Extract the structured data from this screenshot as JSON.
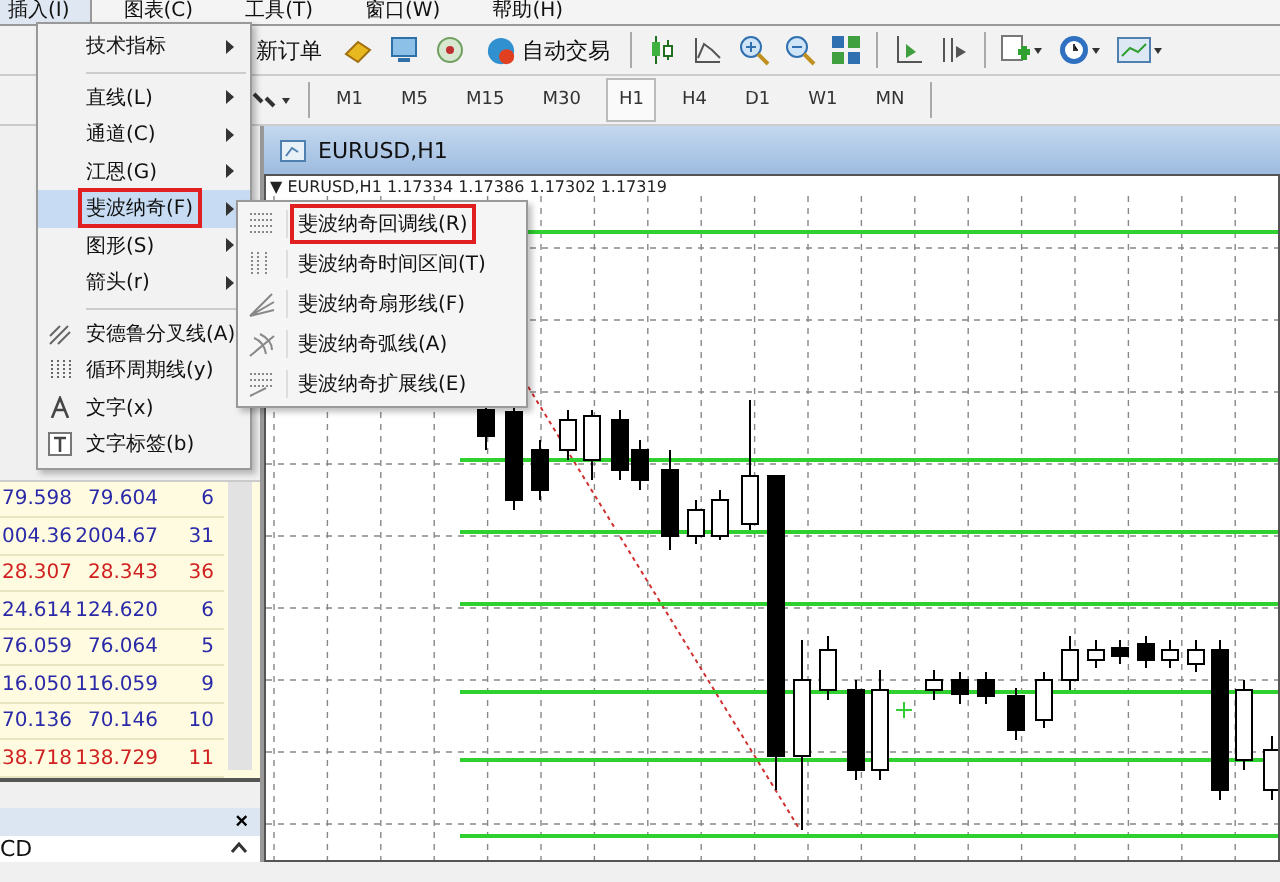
{
  "menu_bar": [
    {
      "label": "插入(I)",
      "selected": true
    },
    {
      "label": "图表(C)",
      "selected": false
    },
    {
      "label": "工具(T)",
      "selected": false
    },
    {
      "label": "窗口(W)",
      "selected": false
    },
    {
      "label": "帮助(H)",
      "selected": false
    }
  ],
  "toolbar": {
    "new_order": "新订单",
    "auto_trading": "自动交易"
  },
  "timeframes": [
    {
      "label": "M1",
      "selected": false
    },
    {
      "label": "M5",
      "selected": false
    },
    {
      "label": "M15",
      "selected": false
    },
    {
      "label": "M30",
      "selected": false
    },
    {
      "label": "H1",
      "selected": true
    },
    {
      "label": "H4",
      "selected": false
    },
    {
      "label": "D1",
      "selected": false
    },
    {
      "label": "W1",
      "selected": false
    },
    {
      "label": "MN",
      "selected": false
    }
  ],
  "insert_menu": {
    "groups": [
      [
        {
          "label": "技术指标",
          "submenu": true,
          "selected": false
        }
      ],
      [
        {
          "label": "直线(L)",
          "submenu": true,
          "selected": false
        },
        {
          "label": "通道(C)",
          "submenu": true,
          "selected": false
        },
        {
          "label": "江恩(G)",
          "submenu": true,
          "selected": false
        },
        {
          "label": "斐波纳奇(F)",
          "submenu": true,
          "selected": true
        },
        {
          "label": "图形(S)",
          "submenu": true,
          "selected": false
        },
        {
          "label": "箭头(r)",
          "submenu": true,
          "selected": false
        }
      ],
      [
        {
          "label": "安德鲁分叉线(A)",
          "submenu": false,
          "selected": false
        },
        {
          "label": "循环周期线(y)",
          "submenu": false,
          "selected": false
        },
        {
          "label": "文字(x)",
          "submenu": false,
          "selected": false
        },
        {
          "label": "文字标签(b)",
          "submenu": false,
          "selected": false
        }
      ]
    ]
  },
  "fibonacci_submenu": [
    {
      "label": "斐波纳奇回调线(R)",
      "selected": true
    },
    {
      "label": "斐波纳奇时间区间(T)",
      "selected": false
    },
    {
      "label": "斐波纳奇扇形线(F)",
      "selected": false
    },
    {
      "label": "斐波纳奇弧线(A)",
      "selected": false
    },
    {
      "label": "斐波纳奇扩展线(E)",
      "selected": false
    }
  ],
  "market_watch": {
    "rows": [
      {
        "bid": "79.598",
        "ask": "79.604",
        "spread": "6",
        "color": "#2a2aa8"
      },
      {
        "bid": "004.36",
        "ask": "2004.67",
        "spread": "31",
        "color": "#2a2aa8"
      },
      {
        "bid": "28.307",
        "ask": "28.343",
        "spread": "36",
        "color": "#d02020"
      },
      {
        "bid": "24.614",
        "ask": "124.620",
        "spread": "6",
        "color": "#2a2aa8"
      },
      {
        "bid": "76.059",
        "ask": "76.064",
        "spread": "5",
        "color": "#2a2aa8"
      },
      {
        "bid": "16.050",
        "ask": "116.059",
        "spread": "9",
        "color": "#2a2aa8"
      },
      {
        "bid": "70.136",
        "ask": "70.146",
        "spread": "10",
        "color": "#2a2aa8"
      },
      {
        "bid": "38.718",
        "ask": "138.729",
        "spread": "11",
        "color": "#d02020"
      }
    ]
  },
  "navigator": {
    "close": "×",
    "item": "CD"
  },
  "chart_window": {
    "title": "EURUSD,H1",
    "info": "▼ EURUSD,H1  1.17334 1.17386 1.17302 1.17319"
  }
}
